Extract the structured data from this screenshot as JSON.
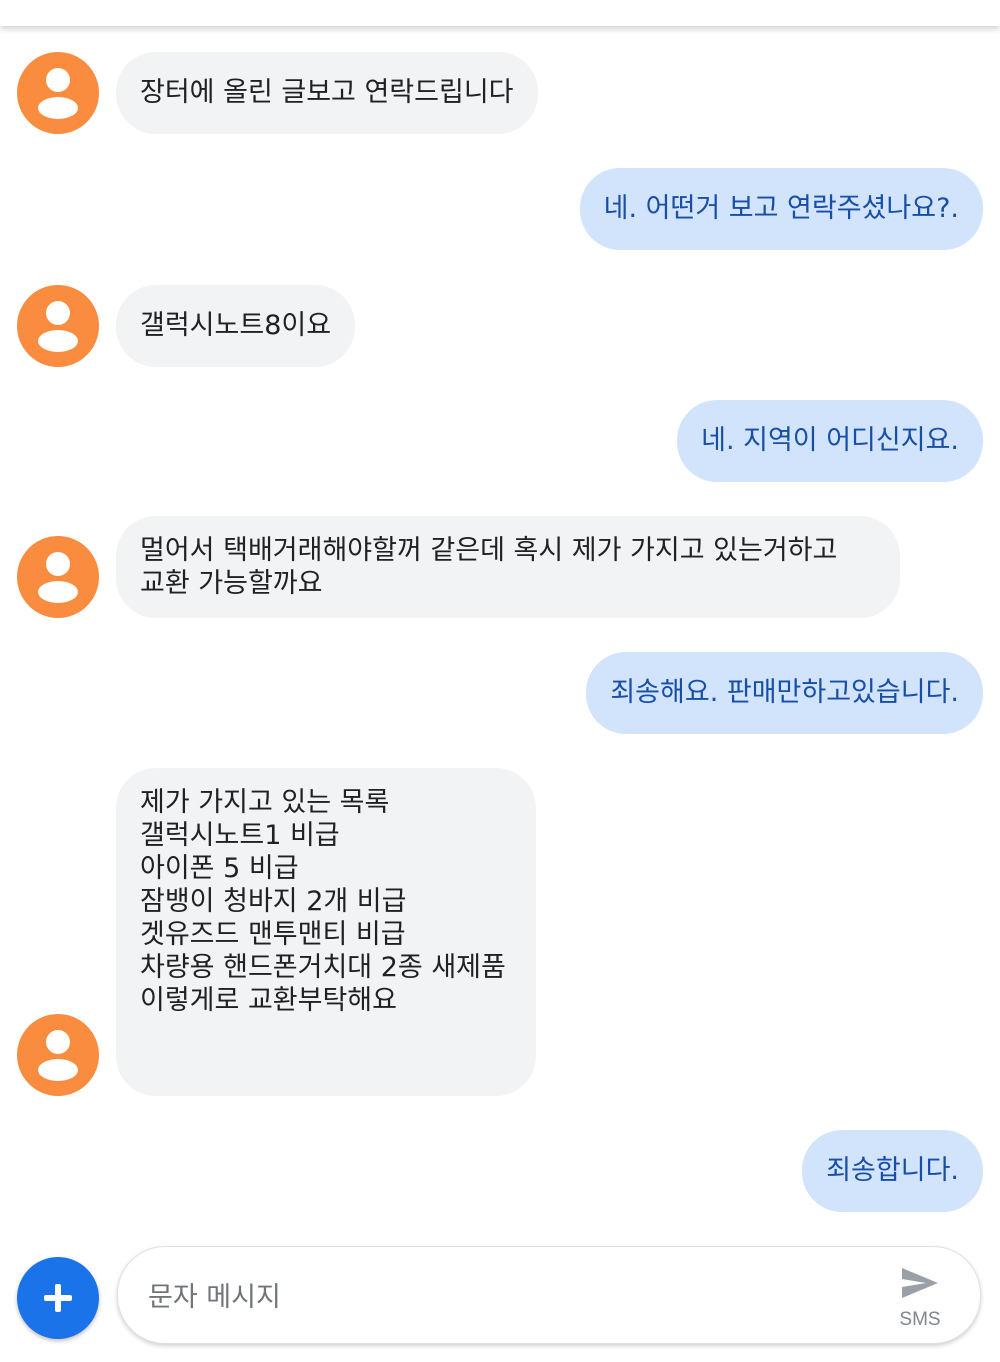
{
  "conversation": {
    "messages": [
      {
        "direction": "incoming",
        "text": "장터에 올린 글보고 연락드립니다"
      },
      {
        "direction": "outgoing",
        "text": "네. 어떤거 보고 연락주셨나요?."
      },
      {
        "direction": "incoming",
        "text": "갤럭시노트8이요"
      },
      {
        "direction": "outgoing",
        "text": "네. 지역이 어디신지요."
      },
      {
        "direction": "incoming",
        "text": "멀어서 택배거래해야할꺼 같은데 혹시 제가 가지고 있는거하고\n교환 가능할까요"
      },
      {
        "direction": "outgoing",
        "text": "죄송해요. 판매만하고있습니다."
      },
      {
        "direction": "incoming",
        "text": "제가 가지고 있는 목록\n갤럭시노트1 비급\n아이폰 5 비급\n잠뱅이 청바지 2개 비급\n겟유즈드 맨투맨티 비급\n차량용 핸드폰거치대 2종 새제품\n이렇게로 교환부탁해요"
      },
      {
        "direction": "outgoing",
        "text": "죄송합니다."
      }
    ]
  },
  "composer": {
    "placeholder": "문자 메시지",
    "value": "",
    "mode_label": "SMS",
    "add_icon": "plus-icon",
    "send_icon": "send-icon"
  },
  "colors": {
    "incoming_bubble": "#f1f3f4",
    "outgoing_bubble": "#d2e3fc",
    "outgoing_text": "#174ea6",
    "avatar": "#f98c3f",
    "accent": "#1a73e8"
  }
}
